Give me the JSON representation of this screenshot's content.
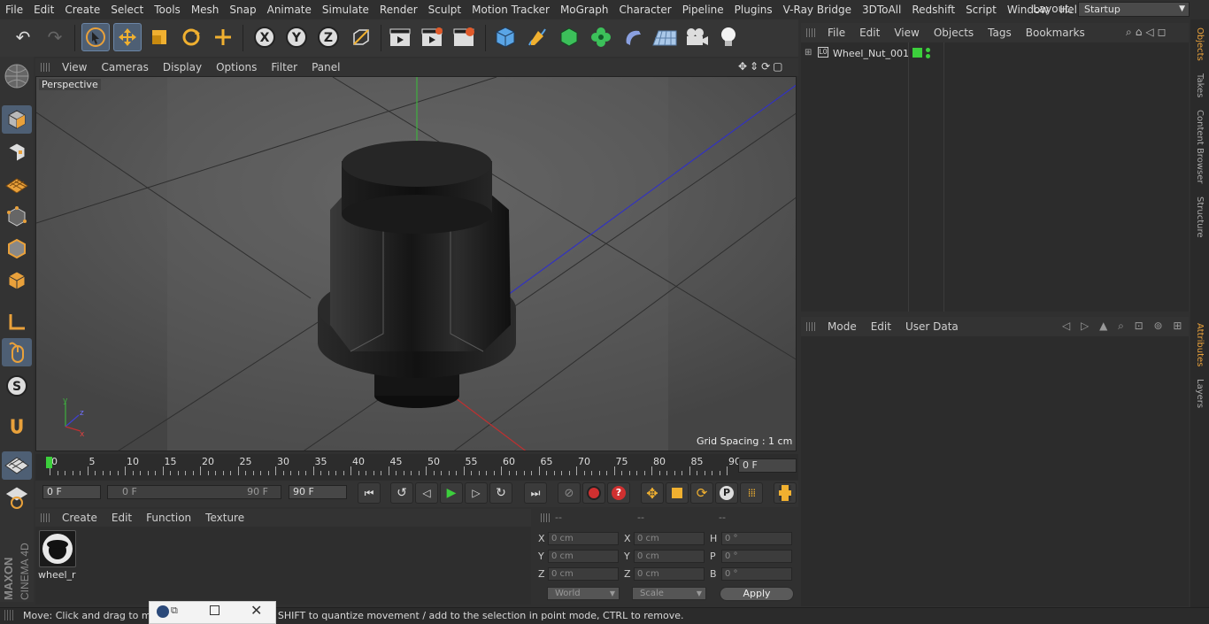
{
  "menu": [
    "File",
    "Edit",
    "Create",
    "Select",
    "Tools",
    "Mesh",
    "Snap",
    "Animate",
    "Simulate",
    "Render",
    "Sculpt",
    "Motion Tracker",
    "MoGraph",
    "Character",
    "Pipeline",
    "Plugins",
    "V-Ray Bridge",
    "3DToAll",
    "Redshift",
    "Script",
    "Window",
    "Help"
  ],
  "layout": {
    "label": "Layout:",
    "value": "Startup"
  },
  "viewport": {
    "menu": [
      "View",
      "Cameras",
      "Display",
      "Options",
      "Filter",
      "Panel"
    ],
    "label": "Perspective",
    "grid_spacing": "Grid Spacing : 1 cm"
  },
  "timeline": {
    "ticks": [
      "0",
      "5",
      "10",
      "15",
      "20",
      "25",
      "30",
      "35",
      "40",
      "45",
      "50",
      "55",
      "60",
      "65",
      "70",
      "75",
      "80",
      "85",
      "90"
    ],
    "current_frame": "0 F",
    "start_field": "0 F",
    "range_start": "0 F",
    "range_end": "90 F",
    "end_field": "90 F"
  },
  "material_manager": {
    "menu": [
      "Create",
      "Edit",
      "Function",
      "Texture"
    ],
    "material_name": "wheel_r"
  },
  "coordinates": {
    "headers": [
      "--",
      "--",
      "--"
    ],
    "rows": [
      {
        "l1": "X",
        "v1": "0 cm",
        "l2": "X",
        "v2": "0 cm",
        "l3": "H",
        "v3": "0 °"
      },
      {
        "l1": "Y",
        "v1": "0 cm",
        "l2": "Y",
        "v2": "0 cm",
        "l3": "P",
        "v3": "0 °"
      },
      {
        "l1": "Z",
        "v1": "0 cm",
        "l2": "Z",
        "v2": "0 cm",
        "l3": "B",
        "v3": "0 °"
      }
    ],
    "world": "World",
    "scale": "Scale",
    "apply": "Apply"
  },
  "object_manager": {
    "menu": [
      "File",
      "Edit",
      "View",
      "Objects",
      "Tags",
      "Bookmarks"
    ],
    "object_name": "Wheel_Nut_001"
  },
  "attributes": {
    "menu": [
      "Mode",
      "Edit",
      "User Data"
    ]
  },
  "right_tabs": [
    "Objects",
    "Takes",
    "Content Browser",
    "Structure",
    "Attributes",
    "Layers"
  ],
  "status": "Move: Click and drag to move elements. Hold down SHIFT to quantize movement / add to the selection in point mode, CTRL to remove.",
  "logo": {
    "line1": "MAXON",
    "line2": "CINEMA 4D"
  },
  "colors": {
    "accent_tab": "#e9a13b",
    "selection": "#4e5f74",
    "green_dot": "#3ccf3c"
  }
}
